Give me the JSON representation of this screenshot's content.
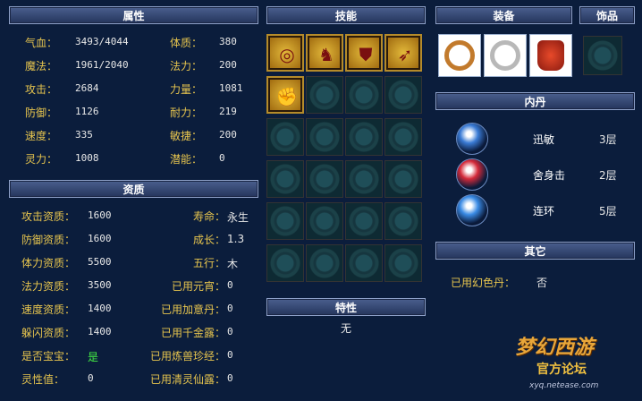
{
  "attributes": {
    "header": "属性",
    "rows": [
      {
        "l1": "气血：",
        "v1": "3493/4044",
        "l2": "体质：",
        "v2": "380"
      },
      {
        "l1": "魔法：",
        "v1": "1961/2040",
        "l2": "法力：",
        "v2": "200"
      },
      {
        "l1": "攻击：",
        "v1": "2684",
        "l2": "力量：",
        "v2": "1081"
      },
      {
        "l1": "防御：",
        "v1": "1126",
        "l2": "耐力：",
        "v2": "219"
      },
      {
        "l1": "速度：",
        "v1": "335",
        "l2": "敏捷：",
        "v2": "200"
      },
      {
        "l1": "灵力：",
        "v1": "1008",
        "l2": "潜能：",
        "v2": "0"
      }
    ]
  },
  "aptitude": {
    "header": "资质",
    "rows": [
      {
        "l1": "攻击资质：",
        "v1": "1600",
        "l2": "寿命：",
        "v2": "永生"
      },
      {
        "l1": "防御资质：",
        "v1": "1600",
        "l2": "成长：",
        "v2": "1.3"
      },
      {
        "l1": "体力资质：",
        "v1": "5500",
        "l2": "五行：",
        "v2": "木"
      },
      {
        "l1": "法力资质：",
        "v1": "3500",
        "l2": "已用元宵：",
        "v2": "0"
      },
      {
        "l1": "速度资质：",
        "v1": "1400",
        "l2": "已用加意丹：",
        "v2": "0"
      },
      {
        "l1": "躲闪资质：",
        "v1": "1400",
        "l2": "已用千金露：",
        "v2": "0"
      },
      {
        "l1": "是否宝宝：",
        "v1": "是",
        "l2": "已用炼兽珍经：",
        "v2": "0"
      },
      {
        "l1": "灵性值：",
        "v1": "0",
        "l2": "已用清灵仙露：",
        "v2": "0"
      }
    ]
  },
  "skills": {
    "header": "技能",
    "icons": [
      "swirl-eye-skill-icon",
      "owl-skill-icon",
      "shield-skill-icon",
      "bow-skill-icon",
      "fist-skill-icon"
    ]
  },
  "traits": {
    "header": "特性",
    "value": "无"
  },
  "equipment": {
    "header": "装备",
    "accessory_header": "饰品"
  },
  "inner_dan": {
    "header": "内丹",
    "items": [
      {
        "name": "迅敏",
        "level": "3层",
        "color": "#3a7bd5"
      },
      {
        "name": "舍身击",
        "level": "2层",
        "color": "#d42a3a"
      },
      {
        "name": "连环",
        "level": "5层",
        "color": "#3a8be5"
      }
    ]
  },
  "other": {
    "header": "其它",
    "label": "已用幻色丹：",
    "value": "否"
  },
  "logo": {
    "brand": "梦幻西游",
    "sub": "官方论坛",
    "url": "xyq.netease.com"
  }
}
